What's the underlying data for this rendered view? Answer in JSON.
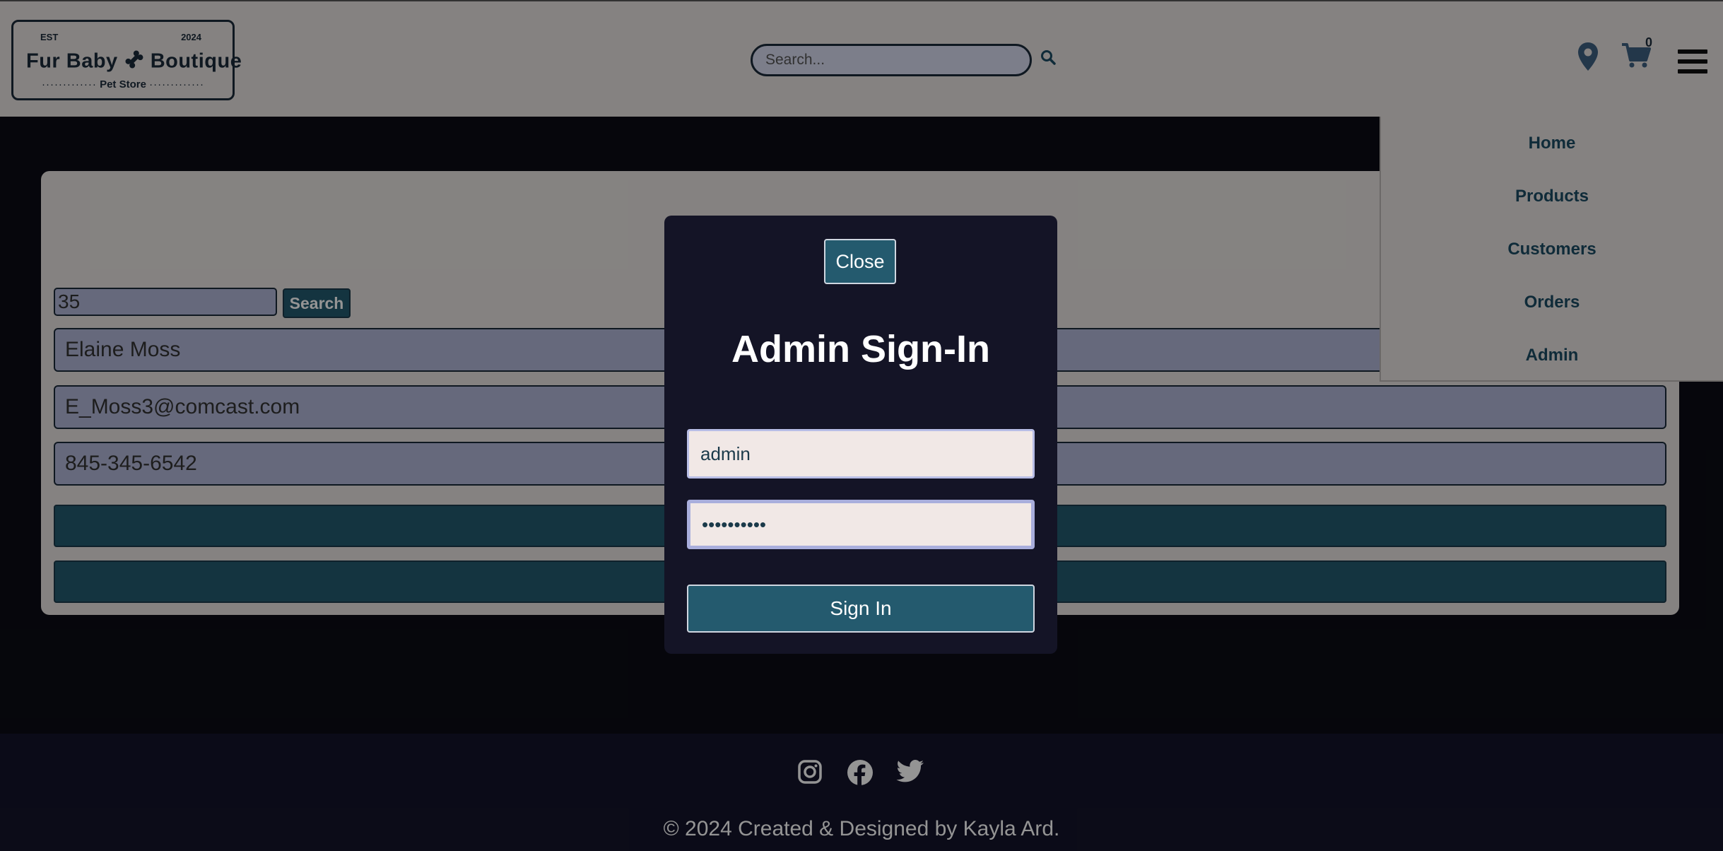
{
  "header": {
    "logo": {
      "est": "EST",
      "year": "2024",
      "name_left": "Fur Baby",
      "name_right": "Boutique",
      "tagline": "Pet Store"
    },
    "search_placeholder": "Search...",
    "cart_count": "0"
  },
  "nav": {
    "items": [
      "Home",
      "Products",
      "Customers",
      "Orders",
      "Admin"
    ]
  },
  "customer_form": {
    "id_value": "35",
    "search_label": "Search",
    "name_value": "Elaine Moss",
    "email_value": "E_Moss3@comcast.com",
    "phone_value": "845-345-6542"
  },
  "modal": {
    "close_label": "Close",
    "title": "Admin Sign-In",
    "username_value": "admin",
    "password_value": "••••••••••",
    "signin_label": "Sign In"
  },
  "footer": {
    "copyright": "© 2024 Created & Designed by Kayla Ard."
  },
  "colors": {
    "accent": "#245a6e",
    "header_bg": "#e6e1de",
    "footer_bg": "#14142a",
    "input_bg": "#b0b6d6"
  }
}
